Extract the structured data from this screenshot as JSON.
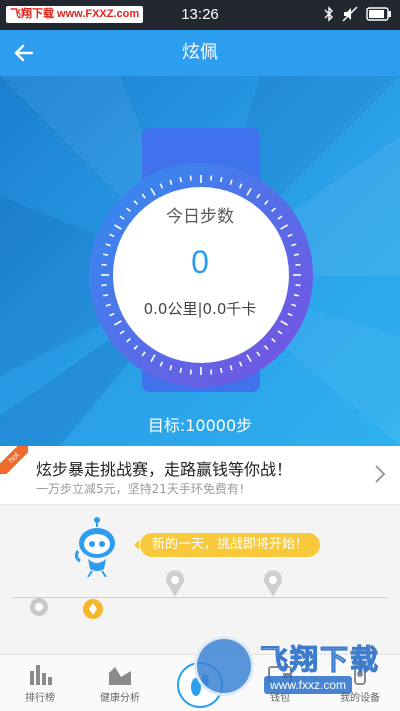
{
  "status_bar": {
    "watermark_badge": "飞翔下载 www.FXXZ.com",
    "time": "13:26",
    "icons": [
      "bluetooth-icon",
      "mute-icon",
      "battery-icon"
    ]
  },
  "header": {
    "title": "炫佩",
    "back_icon": "arrow-left-icon"
  },
  "dashboard": {
    "dial_title": "今日步数",
    "steps": "0",
    "distance_calories": "0.0公里|0.0千卡",
    "goal": "目标:10000步"
  },
  "challenge": {
    "badge": "hot",
    "title": "炫步暴走挑战赛，走路赢钱等你战！",
    "subtitle": "一万步立减5元，坚持21天手环免费有！"
  },
  "timeline": {
    "message": "新的一天，挑战即将开始！"
  },
  "bottom_nav": {
    "items": [
      {
        "label": "排行榜",
        "icon": "bar-chart-icon"
      },
      {
        "label": "健康分析",
        "icon": "area-chart-icon"
      },
      {
        "label": "",
        "icon": "step-icon"
      },
      {
        "label": "钱包",
        "icon": "wallet-icon"
      },
      {
        "label": "我的设备",
        "icon": "device-icon"
      }
    ]
  },
  "site_watermark": {
    "brand": "飞翔下载",
    "url": "www.fxxz.com"
  },
  "colors": {
    "header_blue": "#2d9df0",
    "hero_blue": "#2a9ee8",
    "watch_band": "#3f72ec",
    "steps_number": "#2d9df0",
    "speech_yellow": "#f8c93a",
    "hot_orange": "#f06a2c"
  }
}
